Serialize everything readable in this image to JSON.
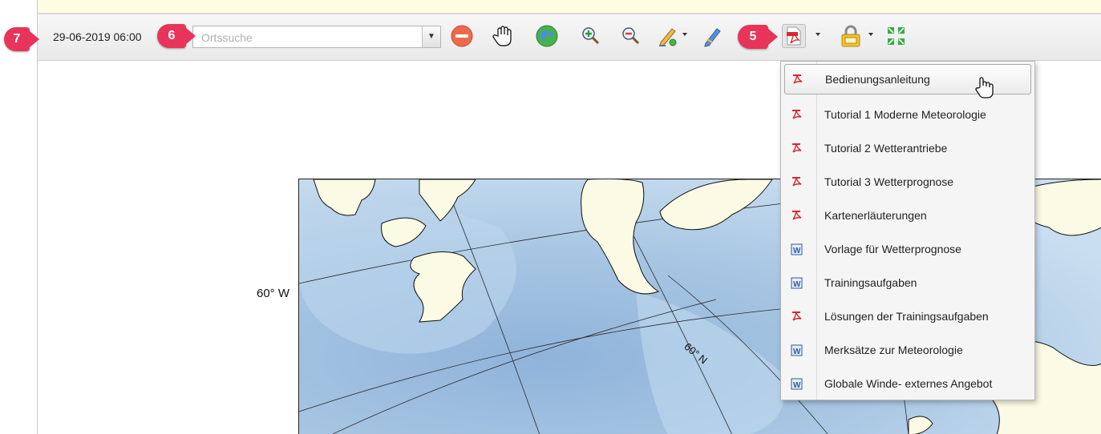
{
  "toolbar": {
    "datetime": "29-06-2019 06:00",
    "search": {
      "placeholder": "Ortssuche",
      "value": ""
    },
    "buttons": [
      {
        "name": "remove-button",
        "icon": "minus-circle-icon"
      },
      {
        "name": "pan-button",
        "icon": "hand-icon"
      },
      {
        "name": "full-extent-button",
        "icon": "globe-icon"
      },
      {
        "name": "zoom-in-button",
        "icon": "zoom-in-icon"
      },
      {
        "name": "zoom-out-button",
        "icon": "zoom-out-icon"
      },
      {
        "name": "draw-button",
        "icon": "pencil-shape-icon"
      },
      {
        "name": "measure-button",
        "icon": "pencil-icon"
      },
      {
        "name": "documents-button",
        "icon": "pdf-icon"
      },
      {
        "name": "lock-button",
        "icon": "lock-icon"
      },
      {
        "name": "fullscreen-button",
        "icon": "arrows-expand-icon"
      }
    ]
  },
  "badges": {
    "b7": "7",
    "b6": "6",
    "b5": "5"
  },
  "map": {
    "label_lon": "60° W",
    "label_lat": "60° N"
  },
  "colors": {
    "badge": "#e8345a",
    "ocean": "#a9c7e3",
    "land": "#fbfbe5",
    "pdf": "#d9262e",
    "word": "#2b5aa8"
  },
  "menu": {
    "items": [
      {
        "label": "Bedienungsanleitung",
        "icon": "pdf-icon"
      },
      {
        "label": "Tutorial 1 Moderne Meteorologie",
        "icon": "pdf-icon"
      },
      {
        "label": "Tutorial 2 Wetterantriebe",
        "icon": "pdf-icon"
      },
      {
        "label": "Tutorial 3 Wetterprognose",
        "icon": "pdf-icon"
      },
      {
        "label": "Kartenerläuterungen",
        "icon": "pdf-icon"
      },
      {
        "label": "Vorlage für Wetterprognose",
        "icon": "word-icon"
      },
      {
        "label": "Trainingsaufgaben",
        "icon": "word-icon"
      },
      {
        "label": "Lösungen der Trainingsaufgaben",
        "icon": "pdf-icon"
      },
      {
        "label": "Merksätze zur Meteorologie",
        "icon": "word-icon"
      },
      {
        "label": "Globale Winde- externes Angebot",
        "icon": "word-icon"
      }
    ]
  }
}
